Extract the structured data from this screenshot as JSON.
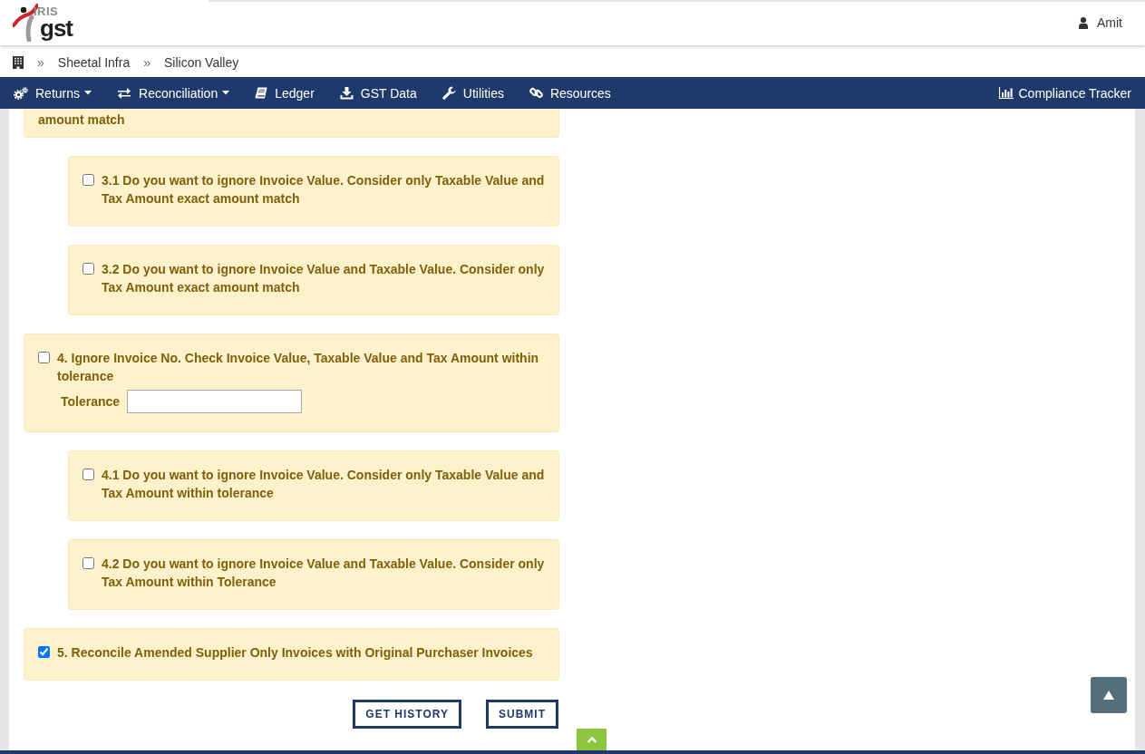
{
  "header": {
    "logo": {
      "top": "IRIS",
      "bottom": "gst"
    },
    "user": "Amit"
  },
  "breadcrumb": [
    {
      "separator": "»",
      "label": "Sheetal Infra"
    },
    {
      "separator": "»",
      "label": "Silicon Valley"
    }
  ],
  "nav": {
    "items": [
      {
        "label": "Returns",
        "dropdown": true
      },
      {
        "label": "Reconciliation",
        "dropdown": true
      },
      {
        "label": "Ledger",
        "dropdown": false
      },
      {
        "label": "GST Data",
        "dropdown": false
      },
      {
        "label": "Utilities",
        "dropdown": false
      },
      {
        "label": "Resources",
        "dropdown": false
      }
    ],
    "right_item": {
      "label": "Compliance Tracker"
    }
  },
  "options": [
    {
      "text": "amount match",
      "children": [
        {
          "text": "3.1 Do you want to ignore Invoice Value. Consider only Taxable Value and Tax Amount exact amount match",
          "checked": false
        },
        {
          "text": "3.2 Do you want to ignore Invoice Value and Taxable Value. Consider only Tax Amount exact amount match",
          "checked": false
        }
      ]
    },
    {
      "text": "4. Ignore Invoice No. Check Invoice Value, Taxable Value and Tax Amount within tolerance",
      "checked": false,
      "tolerance": {
        "label": "Tolerance"
      },
      "children": [
        {
          "text": "4.1 Do you want to ignore Invoice Value. Consider only Taxable Value and Tax Amount within tolerance",
          "checked": false
        },
        {
          "text": "4.2 Do you want to ignore Invoice Value and Taxable Value. Consider only Tax Amount within Tolerance",
          "checked": false
        }
      ]
    },
    {
      "text": "5. Reconcile Amended Supplier Only Invoices with Original Purchaser Invoices",
      "checked": true
    }
  ],
  "buttons": [
    "GET HISTORY",
    "SUBMIT"
  ]
}
